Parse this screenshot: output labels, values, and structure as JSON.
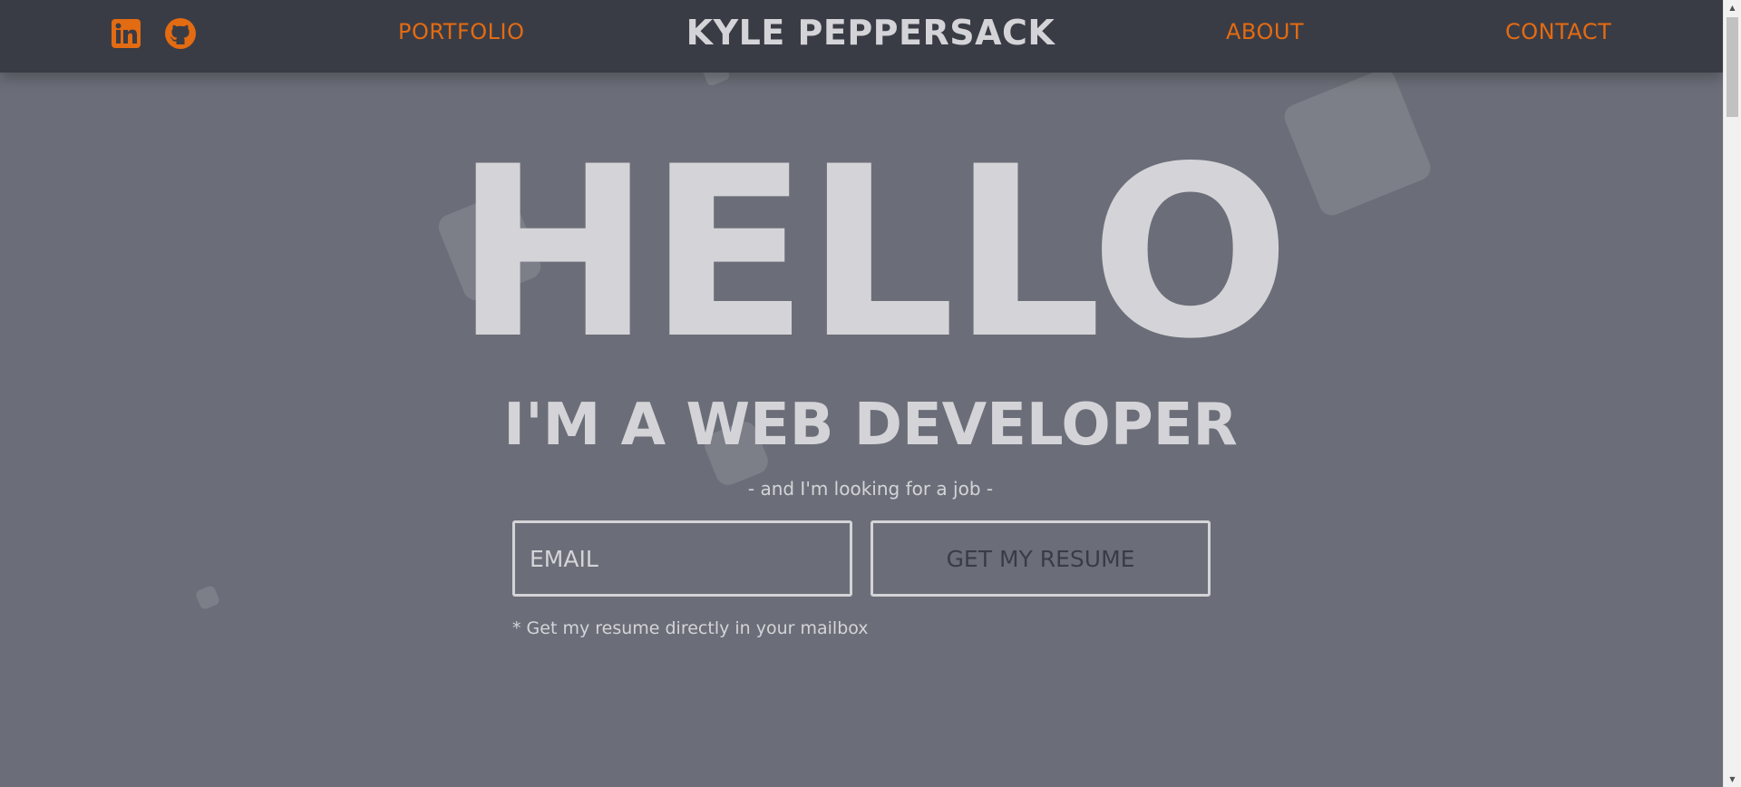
{
  "header": {
    "brand": "KYLE PEPPERSACK",
    "nav": {
      "portfolio": "PORTFOLIO",
      "about": "ABOUT",
      "contact": "CONTACT"
    },
    "social": [
      {
        "icon": "linkedin-icon"
      },
      {
        "icon": "github-icon"
      }
    ]
  },
  "hero": {
    "greeting": "HELLO",
    "tagline": "I'M A WEB DEVELOPER",
    "subline": "- and I'm looking for a job -",
    "email_placeholder": "EMAIL",
    "button_label": "GET MY RESUME",
    "note": "* Get my resume directly in your mailbox"
  },
  "colors": {
    "background": "#6b6e78",
    "header": "#3a3c45",
    "accent": "#e36b12",
    "text": "#d4d4d8"
  }
}
